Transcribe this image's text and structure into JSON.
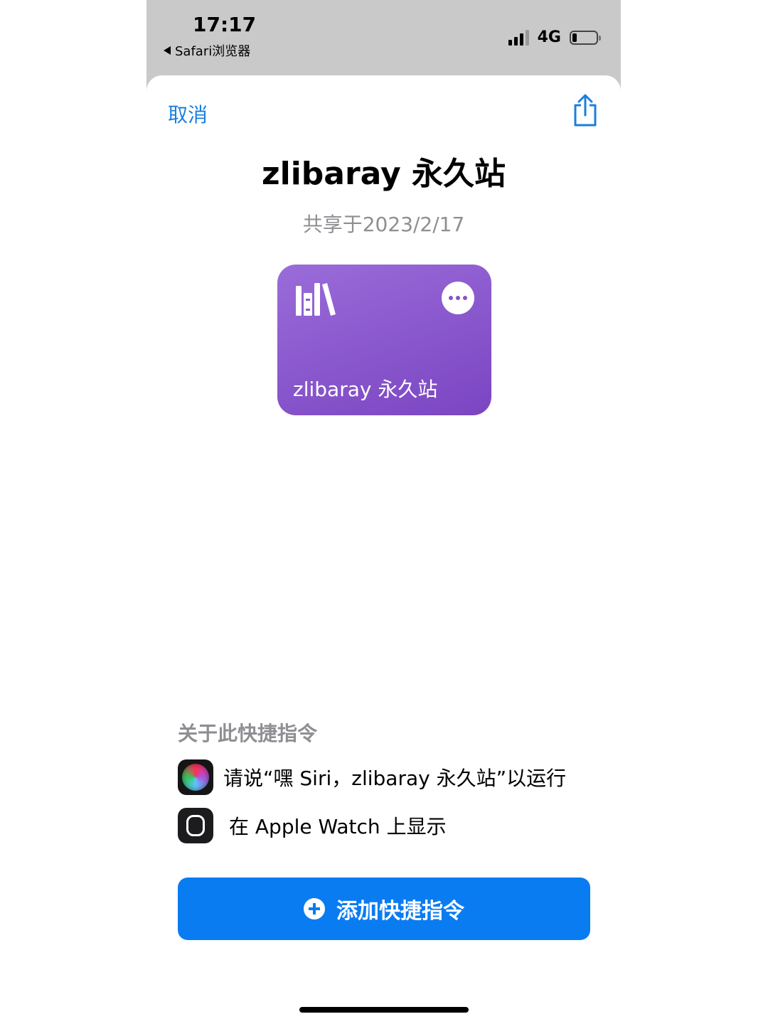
{
  "status_bar": {
    "time": "17:17",
    "back_app": "Safari浏览器",
    "network": "4G",
    "battery_level": 0.2
  },
  "sheet": {
    "cancel_label": "取消",
    "title": "zlibaray 永久站",
    "shared_date": "共享于2023/2/17",
    "card": {
      "title": "zlibaray 永久站",
      "icon": "books-icon",
      "color": "#8a58cf"
    },
    "about": {
      "section_title": "关于此快捷指令",
      "siri_text": "请说“嘿 Siri，zlibaray 永久站”以运行",
      "watch_text": "在 Apple Watch 上显示"
    },
    "add_button": {
      "label": "添加快捷指令",
      "color": "#0a7cf2"
    }
  }
}
